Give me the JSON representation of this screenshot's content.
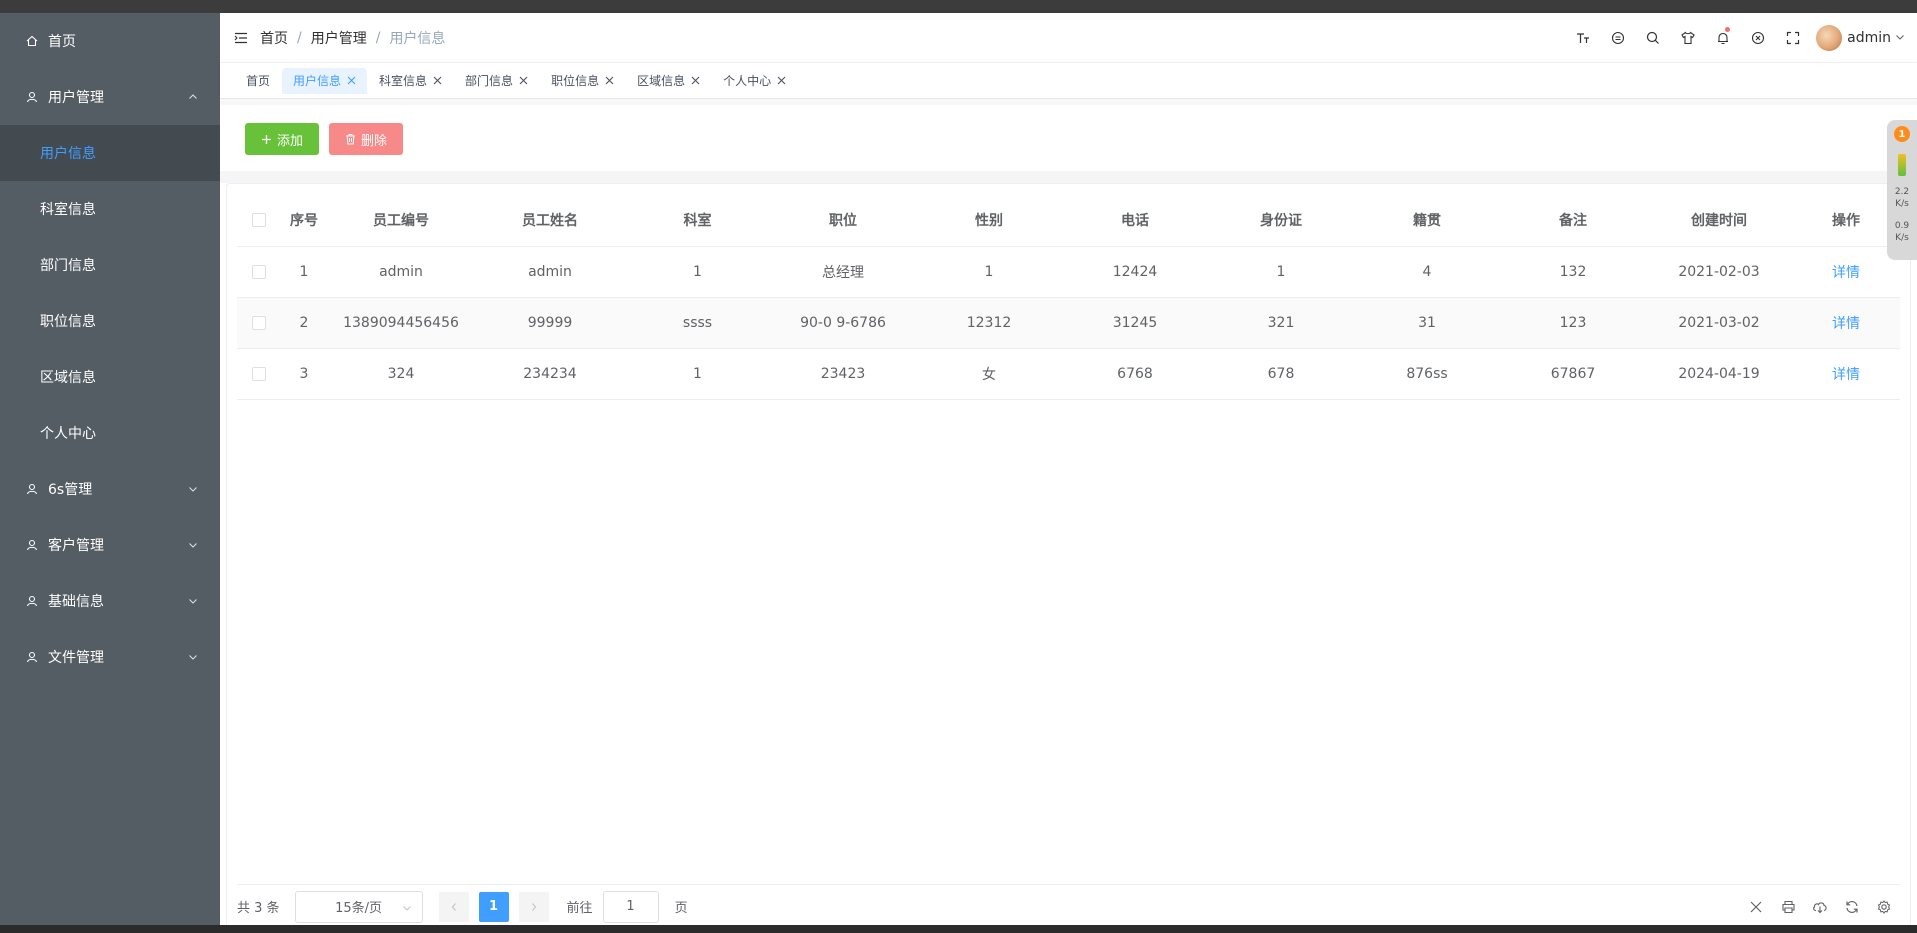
{
  "colors": {
    "sidebar_bg": "#545c64",
    "active_text": "#409eff",
    "success": "#67c23a",
    "danger": "#f78989"
  },
  "sidebar": {
    "home": "首页",
    "user_mgmt": "用户管理",
    "sub_items": [
      "用户信息",
      "科室信息",
      "部门信息",
      "职位信息",
      "区域信息",
      "个人中心"
    ],
    "groups": [
      "6s管理",
      "客户管理",
      "基础信息",
      "文件管理"
    ]
  },
  "breadcrumb": {
    "home": "首页",
    "section": "用户管理",
    "current": "用户信息"
  },
  "user": {
    "name": "admin"
  },
  "tags": [
    "首页",
    "用户信息",
    "科室信息",
    "部门信息",
    "职位信息",
    "区域信息",
    "个人中心"
  ],
  "toolbar": {
    "add_label": "添加",
    "delete_label": "删除"
  },
  "table": {
    "headers": [
      "序号",
      "员工编号",
      "员工姓名",
      "科室",
      "职位",
      "性别",
      "电话",
      "身份证",
      "籍贯",
      "备注",
      "创建时间",
      "操作"
    ],
    "rows": [
      [
        "1",
        "admin",
        "admin",
        "1",
        "总经理",
        "1",
        "12424",
        "1",
        "4",
        "132",
        "2021-02-03",
        "详情"
      ],
      [
        "2",
        "1389094456456",
        "99999",
        "ssss",
        "90-0 9-6786",
        "12312",
        "31245",
        "321",
        "31",
        "123",
        "2021-03-02",
        "详情"
      ],
      [
        "3",
        "324",
        "234234",
        "1",
        "23423",
        "女",
        "6768",
        "678",
        "876ss",
        "67867",
        "2024-04-19",
        "详情"
      ]
    ]
  },
  "pager": {
    "total": "共 3 条",
    "size": "15条/页",
    "current": "1",
    "goto_prefix": "前往",
    "goto_value": "1",
    "goto_suffix": "页"
  },
  "floater": {
    "badge": "1",
    "up": "2.2",
    "down": "0.9",
    "unit": "K/s"
  }
}
